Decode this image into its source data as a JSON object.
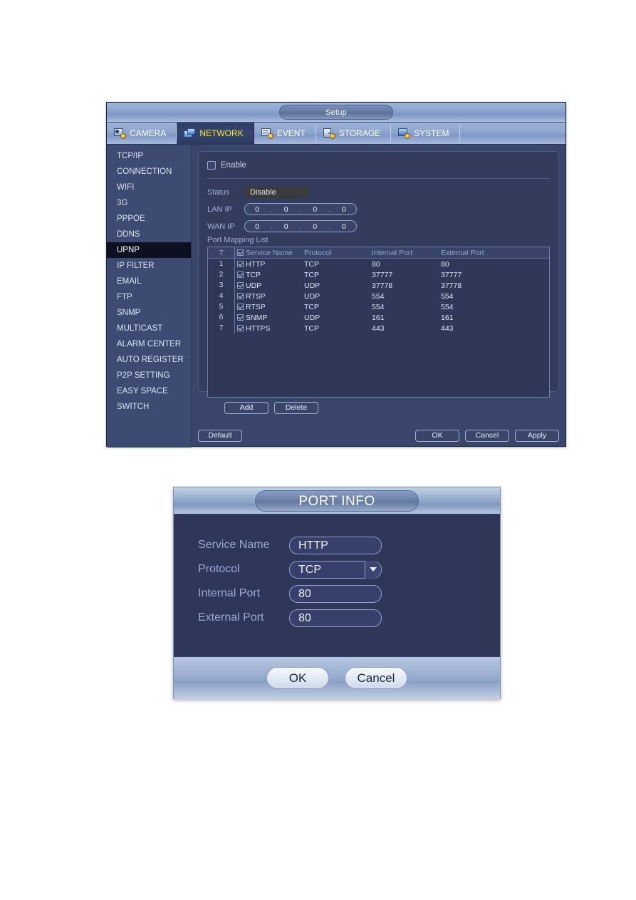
{
  "setup_window": {
    "title": "Setup",
    "tabs": [
      {
        "label": "CAMERA",
        "icon": "camera-icon",
        "active": false
      },
      {
        "label": "NETWORK",
        "icon": "network-icon",
        "active": true
      },
      {
        "label": "EVENT",
        "icon": "event-icon",
        "active": false
      },
      {
        "label": "STORAGE",
        "icon": "storage-icon",
        "active": false
      },
      {
        "label": "SYSTEM",
        "icon": "system-icon",
        "active": false
      }
    ],
    "sidebar": {
      "selected": "UPNP",
      "items": [
        {
          "label": "TCP/IP"
        },
        {
          "label": "CONNECTION"
        },
        {
          "label": "WIFI"
        },
        {
          "label": "3G"
        },
        {
          "label": "PPPOE"
        },
        {
          "label": "DDNS"
        },
        {
          "label": "UPNP"
        },
        {
          "label": "IP FILTER"
        },
        {
          "label": "EMAIL"
        },
        {
          "label": "FTP"
        },
        {
          "label": "SNMP"
        },
        {
          "label": "MULTICAST"
        },
        {
          "label": "ALARM CENTER"
        },
        {
          "label": "AUTO REGISTER"
        },
        {
          "label": "P2P SETTING"
        },
        {
          "label": "EASY SPACE"
        },
        {
          "label": "SWITCH"
        }
      ]
    },
    "form": {
      "enable_label": "Enable",
      "enable_checked": false,
      "status_label": "Status",
      "status_value": "Disable",
      "lan_ip_label": "LAN IP",
      "lan_ip": [
        "0",
        "0",
        "0",
        "0"
      ],
      "wan_ip_label": "WAN IP",
      "wan_ip": [
        "0",
        "0",
        "0",
        "0"
      ],
      "port_mapping_label": "Port Mapping List"
    },
    "table": {
      "header": {
        "index": "7",
        "service_name": "Service Name",
        "protocol": "Protocol",
        "internal_port": "Internal Port",
        "external_port": "External Port"
      },
      "rows": [
        {
          "index": "1",
          "checked": true,
          "service_name": "HTTP",
          "protocol": "TCP",
          "internal_port": "80",
          "external_port": "80"
        },
        {
          "index": "2",
          "checked": true,
          "service_name": "TCP",
          "protocol": "TCP",
          "internal_port": "37777",
          "external_port": "37777"
        },
        {
          "index": "3",
          "checked": true,
          "service_name": "UDP",
          "protocol": "UDP",
          "internal_port": "37778",
          "external_port": "37778"
        },
        {
          "index": "4",
          "checked": true,
          "service_name": "RTSP",
          "protocol": "UDP",
          "internal_port": "554",
          "external_port": "554"
        },
        {
          "index": "5",
          "checked": true,
          "service_name": "RTSP",
          "protocol": "TCP",
          "internal_port": "554",
          "external_port": "554"
        },
        {
          "index": "6",
          "checked": true,
          "service_name": "SNMP",
          "protocol": "UDP",
          "internal_port": "161",
          "external_port": "161"
        },
        {
          "index": "7",
          "checked": true,
          "service_name": "HTTPS",
          "protocol": "TCP",
          "internal_port": "443",
          "external_port": "443"
        }
      ]
    },
    "buttons": {
      "add": "Add",
      "delete": "Delete",
      "default": "Default",
      "ok": "OK",
      "cancel": "Cancel",
      "apply": "Apply"
    }
  },
  "port_dialog": {
    "title": "PORT INFO",
    "fields": {
      "service_name_label": "Service Name",
      "service_name_value": "HTTP",
      "protocol_label": "Protocol",
      "protocol_value": "TCP",
      "internal_port_label": "Internal Port",
      "internal_port_value": "80",
      "external_port_label": "External Port",
      "external_port_value": "80"
    },
    "buttons": {
      "ok": "OK",
      "cancel": "Cancel"
    }
  },
  "colors": {
    "panel_bg": "#333c5c",
    "window_bg": "#39456b",
    "sidebar_bg": "#3d4a72",
    "selected_item_bg": "#0d1020",
    "active_tab_text": "#f5e63c",
    "label_text": "#9fb0dd",
    "dialog_bg": "#2e3659"
  }
}
